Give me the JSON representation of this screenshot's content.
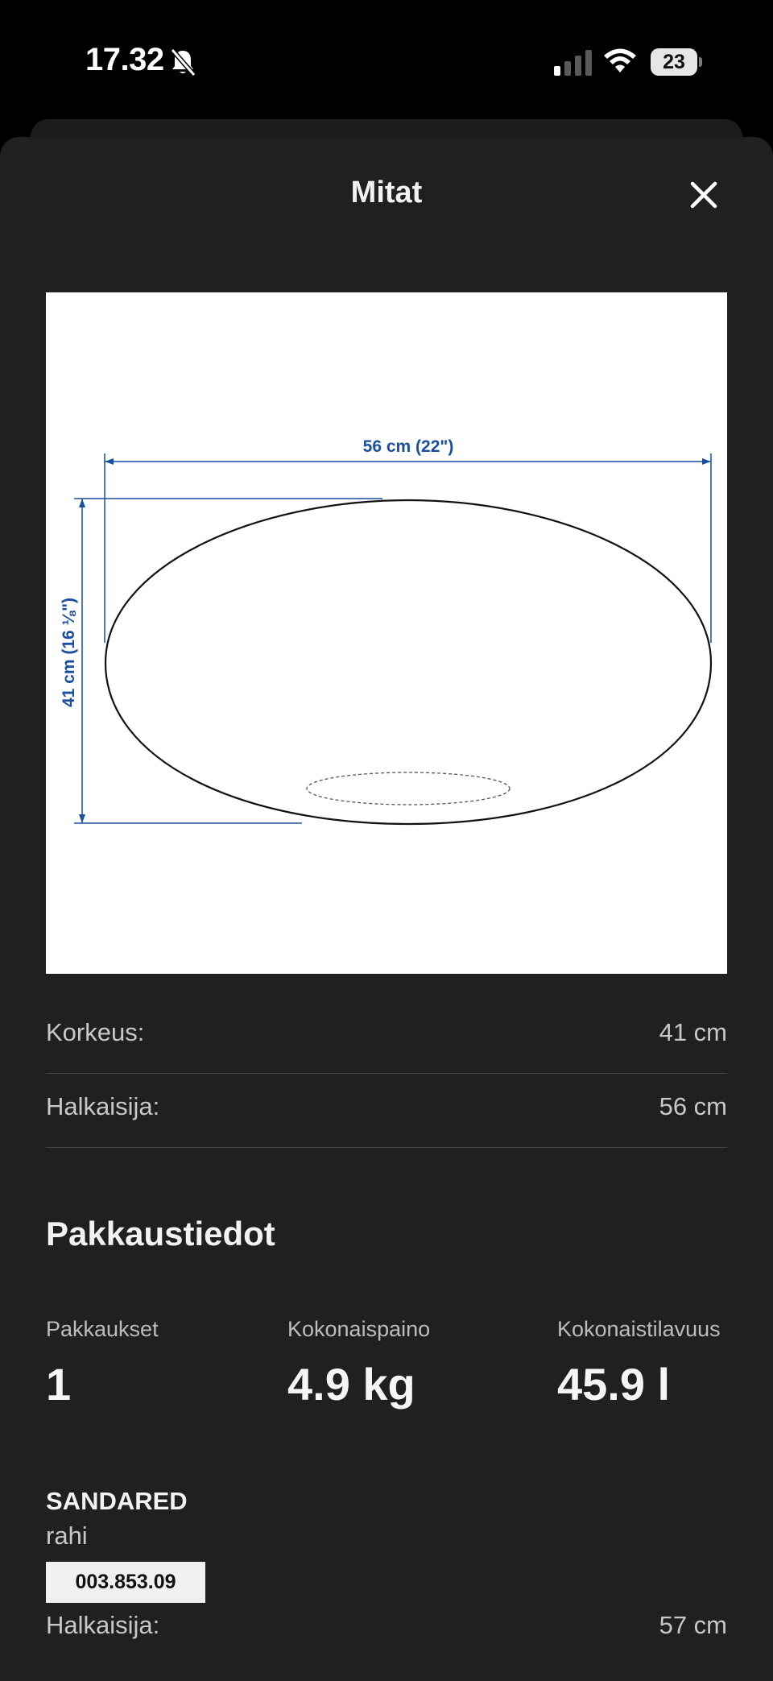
{
  "status_bar": {
    "time": "17.32",
    "battery": "23",
    "icons": [
      "bell-muted-icon",
      "signal-icon",
      "wifi-icon",
      "battery-icon"
    ]
  },
  "sheet": {
    "title": "Mitat",
    "close_icon": "close-icon"
  },
  "diagram": {
    "width_label": "56 cm (22\")",
    "height_label": "41 cm (16 ⅛\")",
    "line_color": "#1a4fa0"
  },
  "dimensions": [
    {
      "label": "Korkeus:",
      "value": "41 cm"
    },
    {
      "label": "Halkaisija:",
      "value": "56 cm"
    }
  ],
  "package": {
    "title": "Pakkaustiedot",
    "stats": [
      {
        "label": "Pakkaukset",
        "value": "1"
      },
      {
        "label": "Kokonaispaino",
        "value": "4.9 kg"
      },
      {
        "label": "Kokonaistilavuus",
        "value": "45.9 l"
      }
    ]
  },
  "product": {
    "name": "SANDARED",
    "type": "rahi",
    "article_number": "003.853.09",
    "rows": [
      {
        "label": "Halkaisija:",
        "value": "57 cm"
      }
    ]
  }
}
